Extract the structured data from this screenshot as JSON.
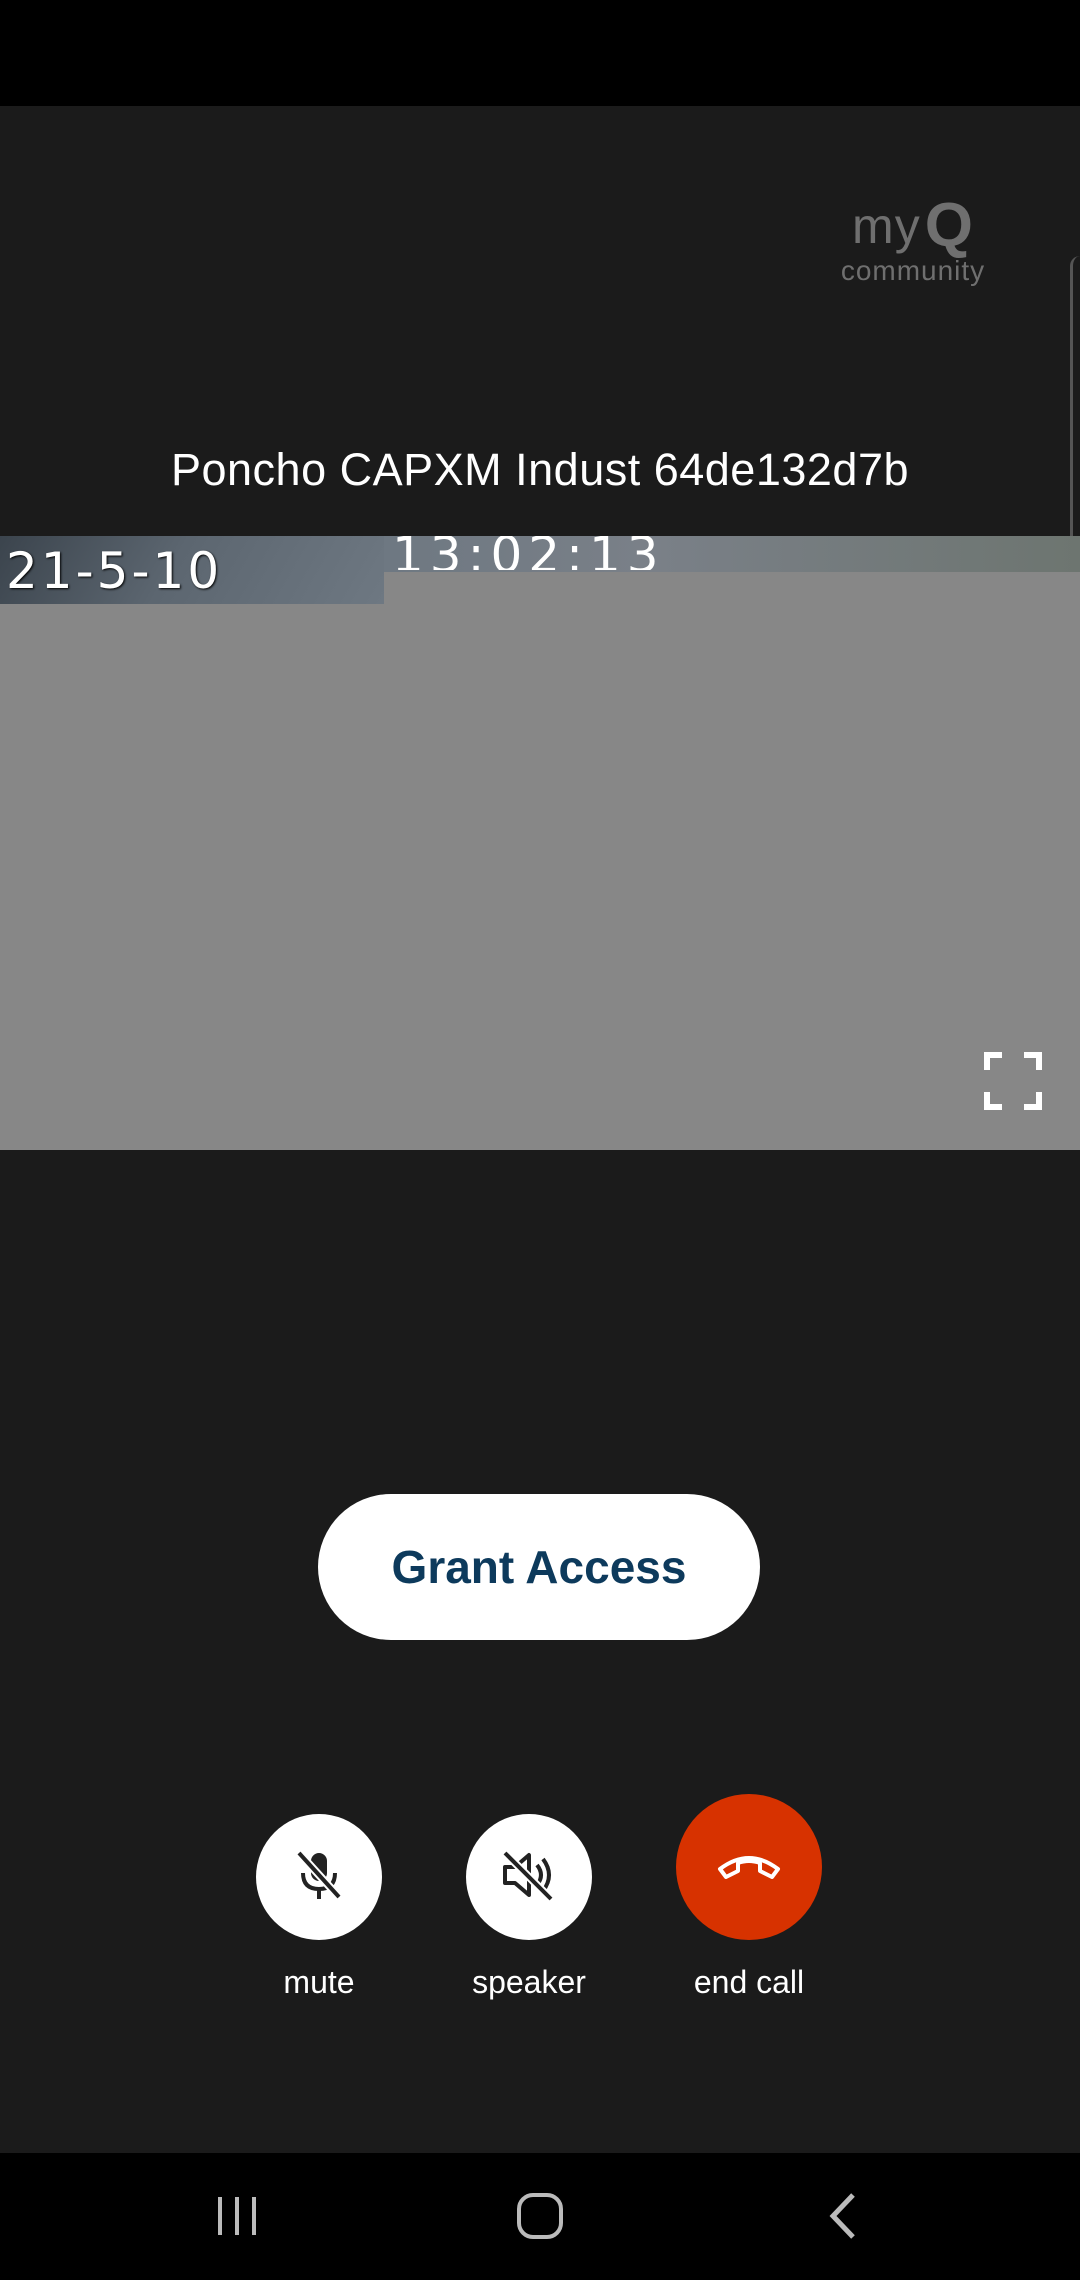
{
  "logo": {
    "word": "my",
    "letter": "Q",
    "sub": "community"
  },
  "device": {
    "name": "Poncho CAPXM Indust 64de132d7b"
  },
  "video": {
    "date_overlay": "21-5-10",
    "time_overlay": "13:02:13"
  },
  "actions": {
    "grant_access_label": "Grant Access"
  },
  "controls": {
    "mute_label": "mute",
    "speaker_label": "speaker",
    "end_call_label": "end call"
  },
  "colors": {
    "background": "#1b1b1b",
    "end_call": "#d73200",
    "grant_text": "#0d3a5c"
  },
  "icons": [
    "mic-off-icon",
    "speaker-off-icon",
    "phone-hangup-icon",
    "fullscreen-icon",
    "nav-recents-icon",
    "nav-home-icon",
    "nav-back-icon"
  ]
}
